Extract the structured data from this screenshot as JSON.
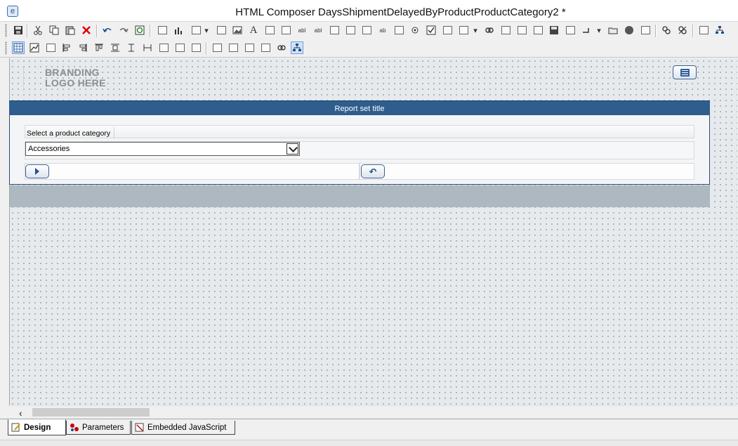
{
  "window": {
    "title": "HTML Composer DaysShipmentDelayedByProductProductCategory2 *"
  },
  "toolbar1": {
    "icons": [
      "save-icon",
      "cut-icon",
      "copy-icon",
      "paste-icon",
      "delete-icon",
      "undo-icon",
      "redo-icon",
      "refresh-icon",
      "page-icon",
      "chart-icon",
      "table-icon",
      "dropdown-icon",
      "frame-icon",
      "image-icon",
      "text-icon",
      "ruler-icon",
      "box-icon",
      "label-icon",
      "textbox-icon",
      "list-icon",
      "listbox-icon",
      "form-icon",
      "field-icon",
      "checkbox-icon",
      "radio-icon",
      "check-icon",
      "grid-icon",
      "tree-icon",
      "dropdown-icon",
      "link-icon",
      "calendar-icon",
      "page-icon",
      "calendar-icon",
      "save-icon",
      "frame-icon",
      "insert-icon",
      "dropdown-icon",
      "folder-icon",
      "circle-icon",
      "textbox-icon",
      "link-icon",
      "unlink-icon",
      "tree-icon",
      "tree-icon"
    ]
  },
  "toolbar2": {
    "icons": [
      "grid-icon",
      "chart-icon",
      "settings-icon",
      "align-left-icon",
      "align-right-icon",
      "align-top-icon",
      "align-center-icon",
      "align-middle-icon",
      "space-icon",
      "space-icon",
      "size-icon",
      "order-icon",
      "order-icon",
      "order-icon",
      "order-icon",
      "link-icon",
      "tree-icon"
    ]
  },
  "branding": {
    "line1": "BRANDING",
    "line2": "LOGO HERE"
  },
  "report": {
    "title": "Report set title"
  },
  "form": {
    "label": "Select a product  category",
    "selected_value": "Accessories"
  },
  "tabs": [
    {
      "label": "Design"
    },
    {
      "label": "Parameters"
    },
    {
      "label": "Embedded JavaScript"
    }
  ]
}
